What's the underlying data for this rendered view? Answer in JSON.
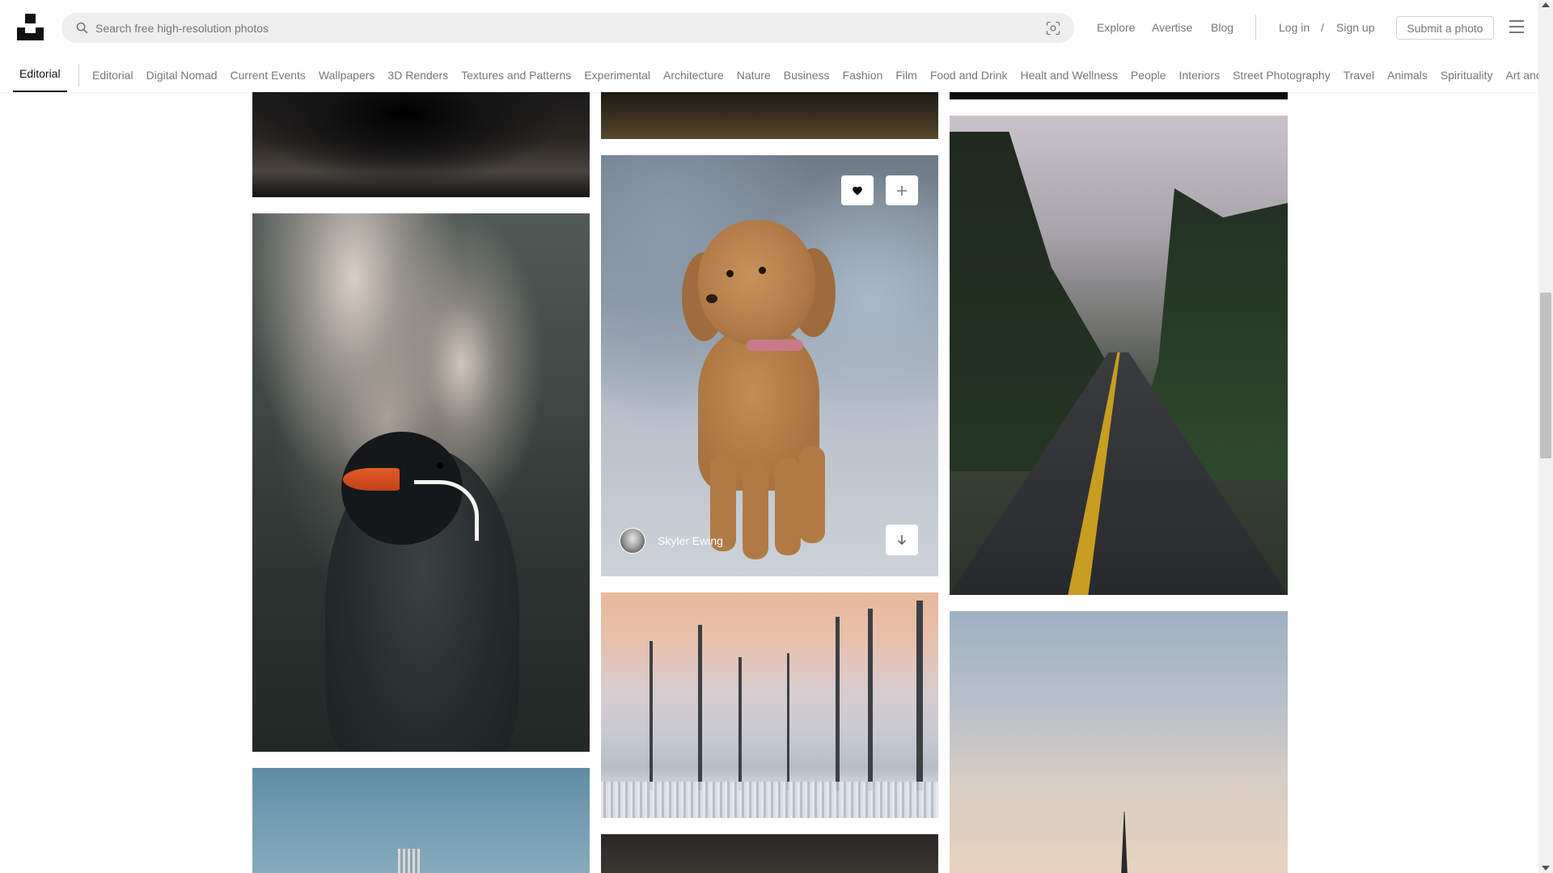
{
  "header": {
    "search_placeholder": "Search free high-resolution photos",
    "nav": {
      "explore": "Explore",
      "advertise": "Avertise",
      "blog": "Blog",
      "login": "Log in",
      "slash": "/",
      "signup": "Sign up",
      "submit": "Submit a photo"
    }
  },
  "topics": {
    "active": "Editorial",
    "items": [
      "Editorial",
      "Digital Nomad",
      "Current Events",
      "Wallpapers",
      "3D Renders",
      "Textures and Patterns",
      "Experimental",
      "Architecture",
      "Nature",
      "Business",
      "Fashion",
      "Film",
      "Food and Drink",
      "Healt and Wellness",
      "People",
      "Interiors",
      "Street Photography",
      "Travel",
      "Animals",
      "Spirituality",
      "Art and Cu"
    ]
  },
  "photos": {
    "hovered": {
      "photographer": "Skyler Ewing"
    }
  },
  "icons": {
    "search": "search-icon",
    "visual_search": "visual-search-icon",
    "menu": "menu-icon",
    "like": "heart-icon",
    "collect": "plus-icon",
    "download": "download-arrow-icon"
  },
  "colors": {
    "text_primary": "#111111",
    "text_secondary": "#767676",
    "search_bg": "#eeeeee",
    "border": "#d1d1d1"
  }
}
